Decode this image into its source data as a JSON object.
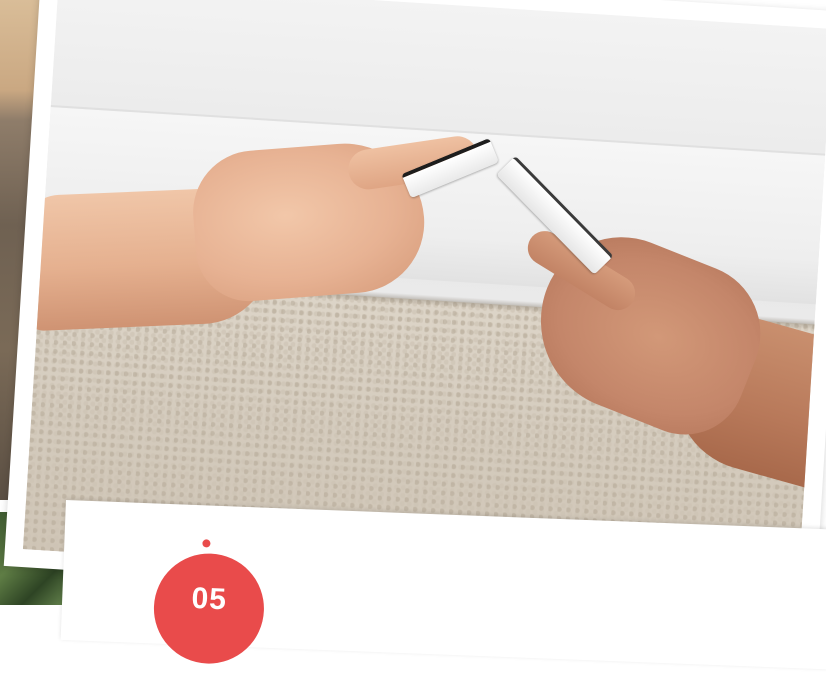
{
  "step": {
    "number": "05",
    "accent_color": "#e94b4b"
  },
  "photo": {
    "subject_icon": "hands-with-smartphones-image"
  }
}
